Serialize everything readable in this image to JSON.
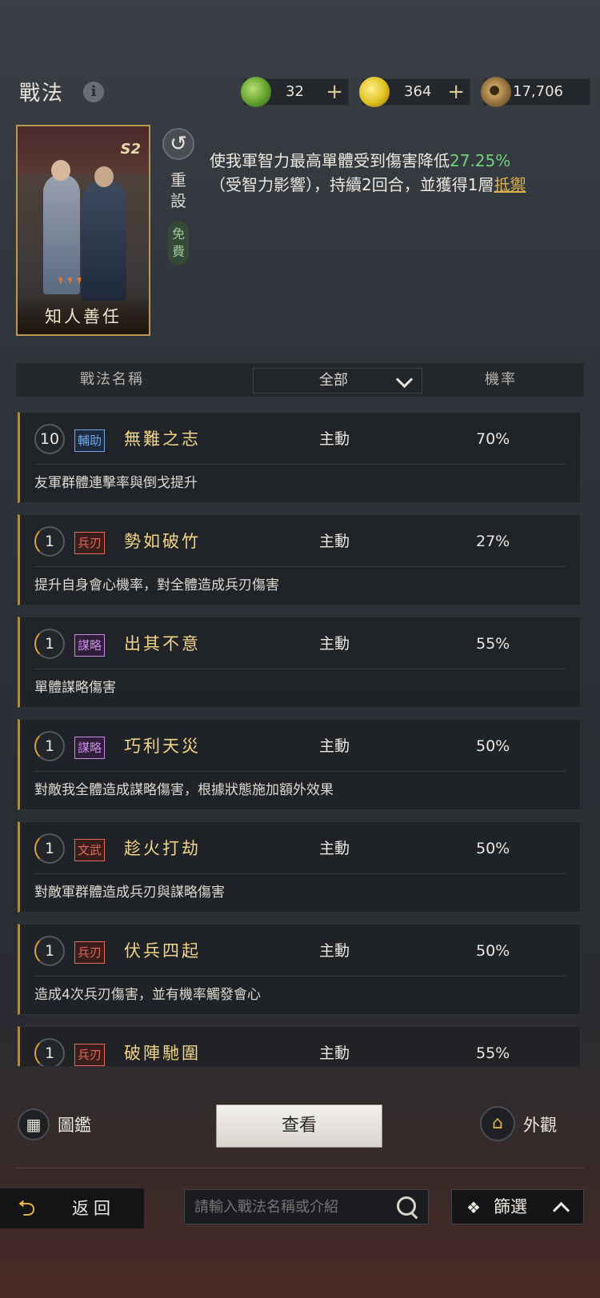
{
  "header": {
    "title": "戰法",
    "info_icon": "i",
    "currencies": [
      {
        "icon": "jade-coin-icon",
        "value": "32",
        "plus": "+"
      },
      {
        "icon": "gold-coin-icon",
        "value": "364",
        "plus": "+"
      },
      {
        "icon": "copper-coin-icon",
        "value": "17,706"
      }
    ]
  },
  "skill_card": {
    "name": "知人善任",
    "badge": "S2",
    "reset_label": "重設",
    "free_label": "免費",
    "desc_before": "使我軍智力最高單體受到傷害降低",
    "desc_value": "27.25%",
    "desc_after": "（受智力影響），持續2回合，並獲得1層",
    "desc_link": "抵禦"
  },
  "table": {
    "col_name": "戰法名稱",
    "filter_value": "全部",
    "col_rate": "機率"
  },
  "skills": [
    {
      "level": "10",
      "tag": "輔助",
      "tag_type": "aux",
      "name": "無難之志",
      "type": "主動",
      "rate": "70%",
      "desc": "友軍群體連擊率與倒戈提升"
    },
    {
      "level": "1",
      "tag": "兵刃",
      "tag_type": "blade",
      "name": "勢如破竹",
      "type": "主動",
      "rate": "27%",
      "desc": "提升自身會心機率，對全體造成兵刃傷害"
    },
    {
      "level": "1",
      "tag": "謀略",
      "tag_type": "plot",
      "name": "出其不意",
      "type": "主動",
      "rate": "55%",
      "desc": "單體謀略傷害"
    },
    {
      "level": "1",
      "tag": "謀略",
      "tag_type": "plot",
      "name": "巧利天災",
      "type": "主動",
      "rate": "50%",
      "desc": "對敵我全體造成謀略傷害，根據狀態施加額外效果"
    },
    {
      "level": "1",
      "tag": "文武",
      "tag_type": "ww",
      "name": "趁火打劫",
      "type": "主動",
      "rate": "50%",
      "desc": "對敵軍群體造成兵刃與謀略傷害"
    },
    {
      "level": "1",
      "tag": "兵刃",
      "tag_type": "blade",
      "name": "伏兵四起",
      "type": "主動",
      "rate": "50%",
      "desc": "造成4次兵刃傷害，並有機率觸發會心"
    },
    {
      "level": "1",
      "tag": "兵刃",
      "tag_type": "blade",
      "name": "破陣馳圍",
      "type": "主動",
      "rate": "55%",
      "desc": ""
    }
  ],
  "bottom": {
    "atlas_label": "圖鑑",
    "view_label": "查看",
    "appearance_label": "外觀",
    "back_label": "返回",
    "search_placeholder": "請輸入戰法名稱或介紹",
    "filter_label": "篩選"
  }
}
